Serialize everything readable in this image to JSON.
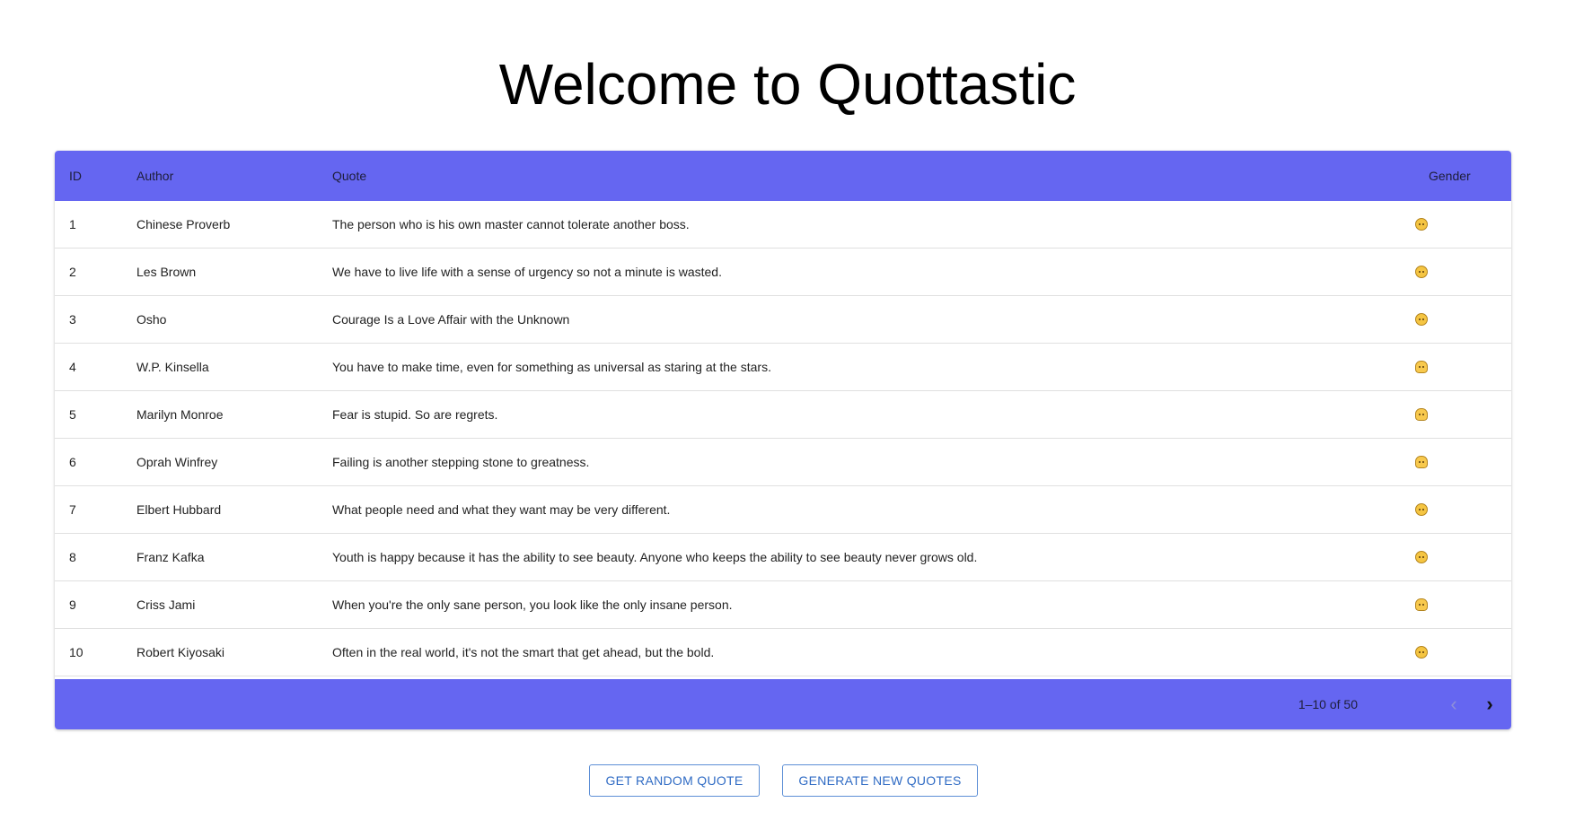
{
  "page": {
    "title": "Welcome to Quottastic"
  },
  "table": {
    "columns": {
      "id": "ID",
      "author": "Author",
      "quote": "Quote",
      "gender": "Gender"
    },
    "rows": [
      {
        "id": "1",
        "author": "Chinese Proverb",
        "quote": "The person who is his own master cannot tolerate another boss.",
        "gender_icon": "man-emoji-icon"
      },
      {
        "id": "2",
        "author": "Les Brown",
        "quote": "We have to live life with a sense of urgency so not a minute is wasted.",
        "gender_icon": "man-emoji-icon"
      },
      {
        "id": "3",
        "author": "Osho",
        "quote": "Courage Is a Love Affair with the Unknown",
        "gender_icon": "man-emoji-icon"
      },
      {
        "id": "4",
        "author": "W.P. Kinsella",
        "quote": "You have to make time, even for something as universal as staring at the stars.",
        "gender_icon": "woman-emoji-icon"
      },
      {
        "id": "5",
        "author": "Marilyn Monroe",
        "quote": "Fear is stupid. So are regrets.",
        "gender_icon": "woman-emoji-icon"
      },
      {
        "id": "6",
        "author": "Oprah Winfrey",
        "quote": "Failing is another stepping stone to greatness.",
        "gender_icon": "woman-emoji-icon"
      },
      {
        "id": "7",
        "author": "Elbert Hubbard",
        "quote": "What people need and what they want may be very different.",
        "gender_icon": "man-emoji-icon"
      },
      {
        "id": "8",
        "author": "Franz Kafka",
        "quote": "Youth is happy because it has the ability to see beauty. Anyone who keeps the ability to see beauty never grows old.",
        "gender_icon": "man-emoji-icon"
      },
      {
        "id": "9",
        "author": "Criss Jami",
        "quote": "When you're the only sane person, you look like the only insane person.",
        "gender_icon": "woman-emoji-icon"
      },
      {
        "id": "10",
        "author": "Robert Kiyosaki",
        "quote": "Often in the real world, it's not the smart that get ahead, but the bold.",
        "gender_icon": "man-emoji-icon"
      }
    ],
    "pagination": {
      "range_label": "1–10 of 50",
      "prev_icon": "chevron-left-icon",
      "next_icon": "chevron-right-icon"
    }
  },
  "actions": {
    "random_label": "GET RANDOM QUOTE",
    "generate_label": "GENERATE NEW QUOTES"
  },
  "colors": {
    "header_bg": "#6566f1",
    "button_border": "#5d8fd6",
    "button_text": "#2f6bc4"
  }
}
